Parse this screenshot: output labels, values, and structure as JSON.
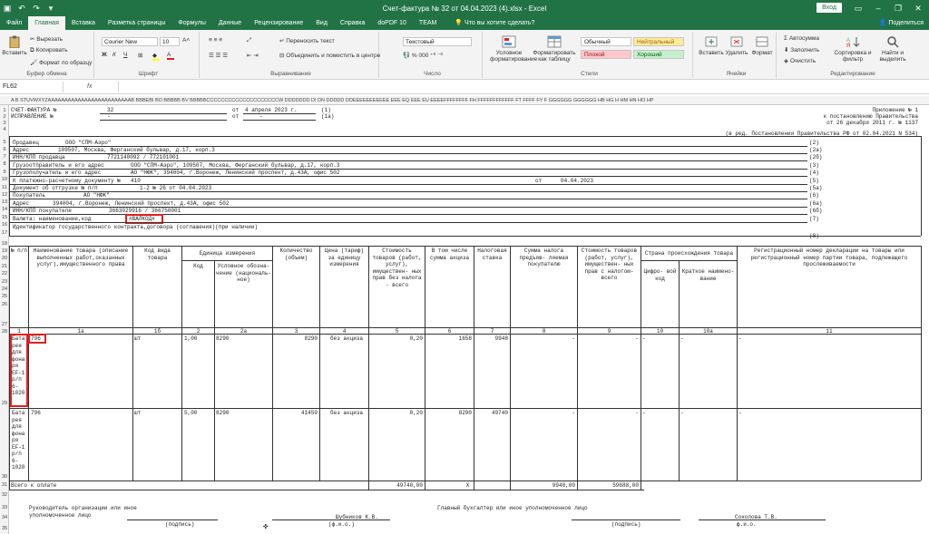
{
  "window": {
    "title": "Счет-фактура № 32 от 04.04.2023 (4).xlsx - Excel",
    "signin": "Вход",
    "share": "Поделиться"
  },
  "tabs": [
    "Файл",
    "Главная",
    "Вставка",
    "Разметка страницы",
    "Формулы",
    "Данные",
    "Рецензирование",
    "Вид",
    "Справка",
    "doPDF 10",
    "TEAM"
  ],
  "active_tab": "Главная",
  "tell_me": "Что вы хотите сделать?",
  "ribbon": {
    "clipboard": {
      "paste": "Вставить",
      "cut": "Вырезать",
      "copy": "Копировать",
      "format_painter": "Формат по образцу",
      "label": "Буфер обмена"
    },
    "font": {
      "name": "Courier New",
      "size": "10",
      "bold": "Ж",
      "italic": "К",
      "underline": "Ч",
      "label": "Шрифт"
    },
    "alignment": {
      "wrap": "Переносить текст",
      "merge": "Объединить и поместить в центре",
      "label": "Выравнивание"
    },
    "number": {
      "format": "Текстовый",
      "label": "Число"
    },
    "styles": {
      "conditional": "Условное форматирование",
      "format_table": "Форматировать как таблицу",
      "normal": "Обычный",
      "neutral": "Нейтральный",
      "bad": "Плохой",
      "good": "Хороший",
      "label": "Стили"
    },
    "cells": {
      "insert": "Вставить",
      "delete": "Удалить",
      "format": "Формат",
      "label": "Ячейки"
    },
    "editing": {
      "autosum": "Автосумма",
      "fill": "Заполнить",
      "clear": "Очистить",
      "sort": "Сортировка и фильтр",
      "find": "Найти и выделить",
      "label": "Редактирование"
    },
    "colors": {
      "fill": "#ffff00",
      "font": "#e0201e",
      "normal_bg": "#ffffff",
      "neutral_bg": "#ffeb9c",
      "neutral_fg": "#9c6500",
      "bad_bg": "#ffc7ce",
      "bad_fg": "#9c0006",
      "good_bg": "#c6efce",
      "good_fg": "#006100"
    }
  },
  "formula_bar": {
    "name_box": "FL62",
    "fx": "fx",
    "value": ""
  },
  "column_header_text": "A B STUVWXYZAAAAAAAAAAAAAAAAAAAAAAAAAB BBBEBI BO BBBBB BV BBBBBCCCCCCCCCCCCCCCCCCCCW DDDDDDD DI DN DDDDD DDEEEEEEEEEEE EEE EQ EEE EU EEEEFFFFFFFF FH FFFFFFFFFFFF FT FFFF FY F GGGGGG GGGGGG HB HG H HM HN HO HP",
  "row_numbers": [
    "1",
    "2",
    "3",
    "4",
    "5",
    "6",
    "7",
    "8",
    "9",
    "10",
    "11",
    "12",
    "13",
    "14",
    "15",
    "16",
    "17",
    "18",
    "19",
    "20",
    "21",
    "22",
    "23",
    "24",
    "25",
    "26",
    "27",
    "28",
    "29",
    "30",
    "31",
    "32",
    "33",
    "34",
    "35"
  ],
  "sheet": {
    "invoice_label": "СЧЕТ-ФАКТУРА №",
    "invoice_no": "32",
    "from1": "от",
    "invoice_date": "4 апреля 2023 г.",
    "n1": "(1)",
    "correction_label": "ИСПРАВЛЕНИЕ №",
    "dash1": "-",
    "from2": "от",
    "dash2": "-",
    "n1a": "(1а)",
    "appendix": "Приложение № 1",
    "appendix2": "к постановлению Правительства",
    "appendix3": "от 26 декабря 2011 г. № 1137",
    "appendix4": "(в ред. Постановления Правительства РФ от 02.04.2021 N 534)",
    "seller_label": "Продавец",
    "seller": "ООО \"СПМ-Аэро\"",
    "n2": "(2)",
    "address_label": "Адрес",
    "seller_address": "109507, Москва, Ферганский бульвар, д.17, корп.3",
    "n2a": "(2а)",
    "inn_label": "ИНН/КПП продавца",
    "seller_inn": "7721140092 / 772101001",
    "n2b": "(2б)",
    "shipper_label": "Грузоотправитель и его адрес",
    "shipper": "ООО \"СПМ-Аэро\", 109507, Москва, Ферганский бульвар, д.17, корп.3",
    "n3": "(3)",
    "consignee_label": "Грузополучатель и его адрес",
    "consignee": "АО \"НФК\", 394004, г.Воронеж, Ленинский проспект, д.43А, офис 502",
    "n4": "(4)",
    "payment_doc_label": "К платежно-расчетному документу №",
    "payment_doc_no": "410",
    "from3": "от",
    "payment_doc_date": "04.04.2023",
    "n5": "(5)",
    "shipping_doc_label": "Документ об отгрузке № п/п",
    "shipping_doc": "1-2 № 26 от 04.04.2023",
    "n5a": "(5а)",
    "buyer_label": "Покупатель",
    "buyer": "АО \"НФК\"",
    "n6": "(6)",
    "buyer_address_label": "Адрес",
    "buyer_address": "394004, г.Воронеж, Ленинский проспект, д.43А, офис 502",
    "n6a": "(6а)",
    "buyer_inn_label": "ИНН/КПП покупателя",
    "buyer_inn": "3663029916 / 366750001",
    "n6b": "(6б)",
    "currency_label": "Валюта: наименование,код",
    "currency": "#ВАЛКОД#",
    "n7": "(7)",
    "gov_id_label": "Идентификатор государственного контракта,договора (соглашения)(при наличии)",
    "n8": "(8)",
    "headers": {
      "num": "№ п/п",
      "name": "Наименование товара (описание выполненных работ,оказанных услуг),имущественного права",
      "kind_code": "Код вида товара",
      "unit": "Единица измерения",
      "unit_code": "Код",
      "unit_name": "Условное обозна- чение (националь- ное)",
      "qty": "Количество (объем)",
      "price": "Цена (тариф) за единицу измерения",
      "cost_no_tax": "Стоимость товаров (работ, услуг), имуществен- ных прав без налога - всего",
      "excise": "В том числе сумма акциза",
      "tax_rate": "Налоговая ставка",
      "tax_sum": "Сумма налога предъяв- ляемая покупателю",
      "cost_with_tax": "Стоимость товаров (работ, услуг), имуществен- ных прав с налогом- всего",
      "country": "Страна происхождения товара",
      "country_code": "Цифро- вой код",
      "country_name": "Краткое наимено- вание",
      "declaration": "Регистрационный номер декларации на товары или регистрационный номер партии товара, подлежащего прослеживаемости"
    },
    "col_numbers": [
      "1",
      "1а",
      "1б",
      "2",
      "2а",
      "3",
      "4",
      "5",
      "6",
      "7",
      "8",
      "9",
      "10",
      "10а",
      "11"
    ],
    "rows": [
      {
        "name": "Бата рея для фона ря EF-1 р/п 6- 1020",
        "code": "796",
        "kind": "шт",
        "unit_code": "1,00",
        "unit_name": "8290",
        "qty": "8290",
        "price": "без акциза",
        "cost": "0,20",
        "excise": "1658",
        "rate": "9948",
        "tax": "-",
        "total": "-",
        "c10": "-",
        "c10a": "-",
        "c11": "-"
      },
      {
        "name": "Бата рея для фона ря EF-1 р/п 6- 1020",
        "code": "796",
        "kind": "шт",
        "unit_code": "5,00",
        "unit_name": "8290",
        "qty": "41450",
        "price": "без акциза",
        "cost": "0,20",
        "excise": "8290",
        "rate": "49740",
        "tax": "-",
        "total": "-",
        "c10": "-",
        "c10a": "-",
        "c11": "-"
      }
    ],
    "total_label": "Всего к оплате",
    "total_cost": "49740,00",
    "total_x": "Х",
    "total_tax": "9948,00",
    "total_with_tax": "59688,00",
    "head_label": "Руководитель организации или иное уполномоченное лицо",
    "head_name": "Шубников К.В.",
    "accountant_label": "Главный бухгалтер или иное уполномоченное лицо",
    "accountant_name": "Соколова Т.В.",
    "signature": "(подпись)",
    "fio": "(ф.и.о.)",
    "signature2": "(подпись)",
    "fio2": "ф.и.о."
  }
}
